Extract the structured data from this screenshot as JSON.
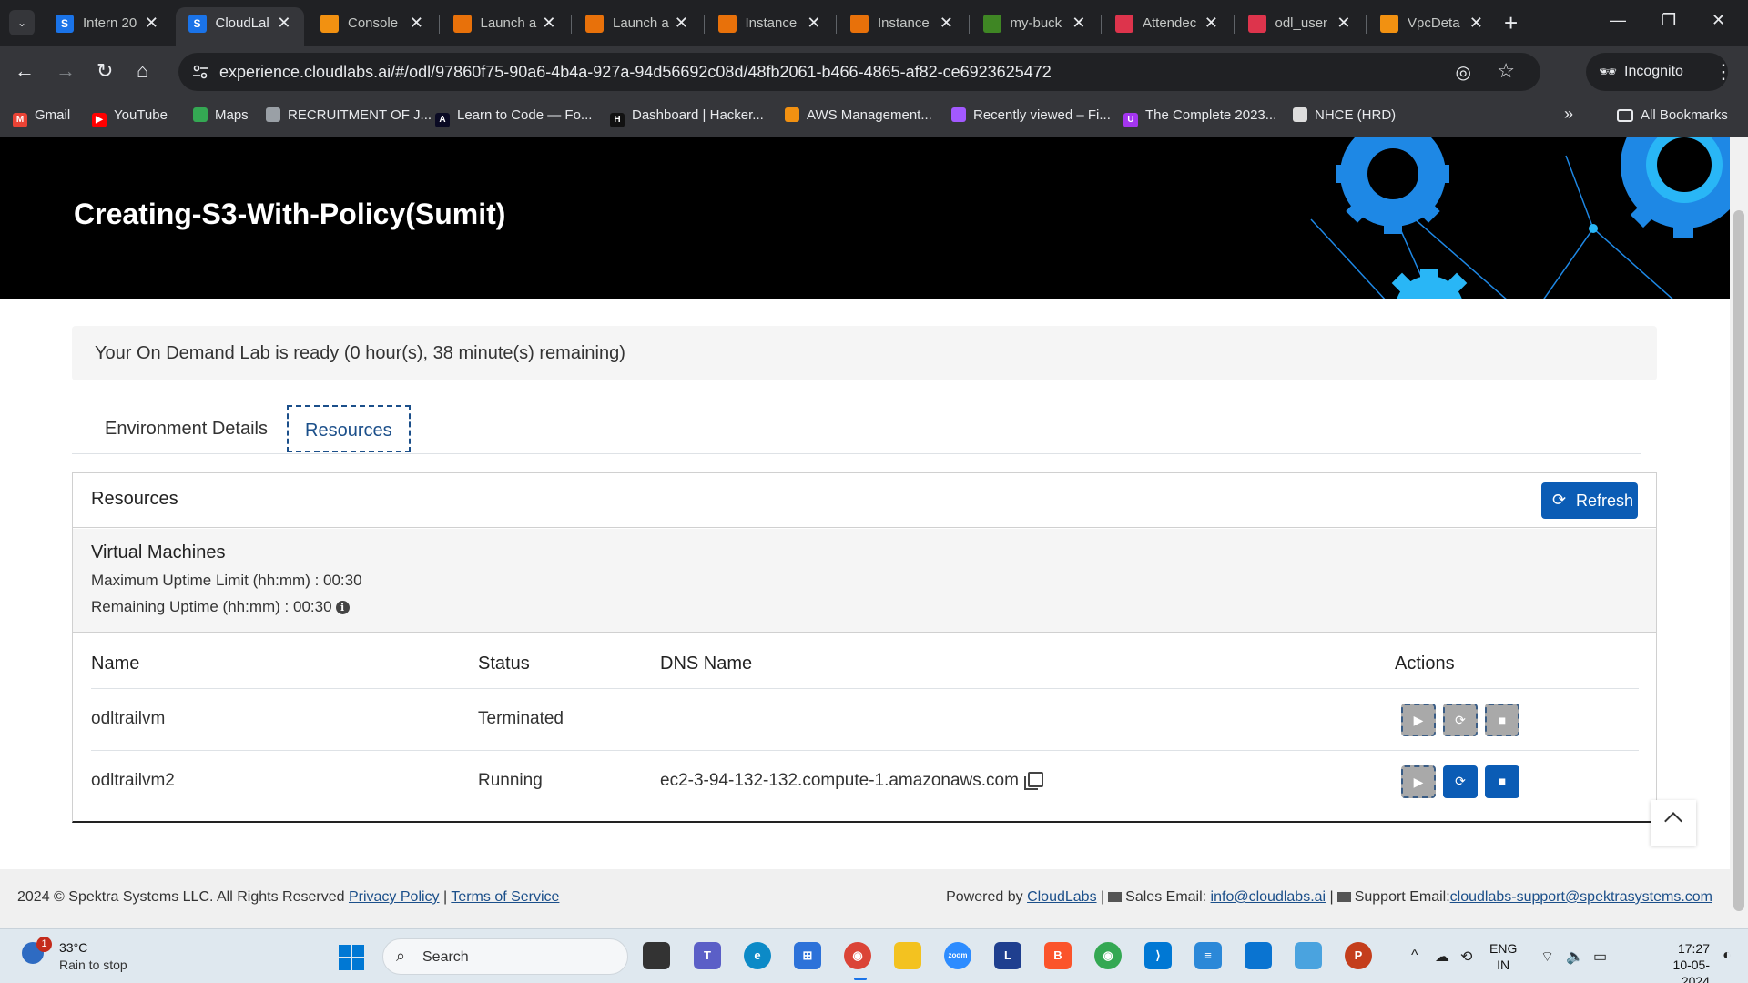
{
  "browser": {
    "tabs": [
      {
        "title": "Intern 20",
        "favicon": "S",
        "color": "#1a73e8"
      },
      {
        "title": "CloudLal",
        "favicon": "S",
        "color": "#1a73e8"
      },
      {
        "title": "Console",
        "favicon": "",
        "color": "#f29111"
      },
      {
        "title": "Launch a",
        "favicon": "",
        "color": "#e8710a"
      },
      {
        "title": "Launch a",
        "favicon": "",
        "color": "#e8710a"
      },
      {
        "title": "Instance",
        "favicon": "",
        "color": "#e8710a"
      },
      {
        "title": "Instance",
        "favicon": "",
        "color": "#e8710a"
      },
      {
        "title": "my-buck",
        "favicon": "",
        "color": "#3f8624"
      },
      {
        "title": "Attendec",
        "favicon": "",
        "color": "#dd344c"
      },
      {
        "title": "odl_user",
        "favicon": "",
        "color": "#dd344c"
      },
      {
        "title": "VpcDeta",
        "favicon": "",
        "color": "#f29111"
      }
    ],
    "active_tab_index": 1,
    "url": "experience.cloudlabs.ai/#/odl/97860f75-90a6-4b4a-927a-94d56692c08d/48fb2061-b466-4865-af82-ce6923625472",
    "incognito_label": "Incognito",
    "bookmarks": [
      {
        "label": "Gmail",
        "color": "#ea4335",
        "glyph": "M"
      },
      {
        "label": "YouTube",
        "color": "#ff0000",
        "glyph": "▶"
      },
      {
        "label": "Maps",
        "color": "#34a853",
        "glyph": ""
      },
      {
        "label": "RECRUITMENT OF J...",
        "color": "#9aa0a6",
        "glyph": ""
      },
      {
        "label": "Learn to Code — Fo...",
        "color": "#0a0a23",
        "glyph": "A"
      },
      {
        "label": "Dashboard | Hacker...",
        "color": "#111",
        "glyph": "H"
      },
      {
        "label": "AWS Management...",
        "color": "#f29111",
        "glyph": ""
      },
      {
        "label": "Recently viewed – Fi...",
        "color": "#a259ff",
        "glyph": ""
      },
      {
        "label": "The Complete 2023...",
        "color": "#a435f0",
        "glyph": "U"
      },
      {
        "label": "NHCE (HRD)",
        "color": "#ddd",
        "glyph": ""
      }
    ],
    "all_bookmarks_label": "All Bookmarks"
  },
  "page": {
    "lab_title": "Creating-S3-With-Policy(Sumit)",
    "status_message": "Your On Demand Lab is ready (0 hour(s), 38 minute(s) remaining)",
    "tabs": [
      {
        "label": "Environment Details",
        "active": false
      },
      {
        "label": "Resources",
        "active": true
      }
    ],
    "resources": {
      "title": "Resources",
      "refresh_label": "Refresh",
      "vm_section_title": "Virtual Machines",
      "max_uptime": "Maximum Uptime Limit (hh:mm) : 00:30",
      "remaining_uptime": "Remaining Uptime (hh:mm) : 00:30",
      "columns": [
        "Name",
        "Status",
        "DNS Name",
        "Actions"
      ],
      "rows": [
        {
          "name": "odltrailvm",
          "status": "Terminated",
          "dns": "",
          "actions_enabled": [
            false,
            false,
            false
          ]
        },
        {
          "name": "odltrailvm2",
          "status": "Running",
          "dns": "ec2-3-94-132-132.compute-1.amazonaws.com",
          "actions_enabled": [
            false,
            true,
            true
          ]
        }
      ]
    },
    "footer": {
      "copyright": "2024 © Spektra Systems LLC. All Rights Reserved",
      "privacy_link": "Privacy Policy",
      "separator": "|",
      "terms_link": "Terms of Service",
      "powered_by": "Powered by",
      "cloudlabs_link": "CloudLabs",
      "sales_label": "Sales Email:",
      "sales_email": "info@cloudlabs.ai",
      "support_label": "Support Email:",
      "support_email": "cloudlabs-support@spektrasystems.com"
    }
  },
  "taskbar": {
    "weather_temp": "33°C",
    "weather_desc": "Rain to stop",
    "weather_badge": "1",
    "search_placeholder": "Search",
    "lang_top": "ENG",
    "lang_bottom": "IN",
    "time": "17:27",
    "date": "10-05-2024"
  },
  "colors": {
    "brand_blue": "#0b5cb5",
    "banner_bg": "#000000",
    "gear_blue": "#1e88e5",
    "gear_cyan": "#29b6f6"
  }
}
